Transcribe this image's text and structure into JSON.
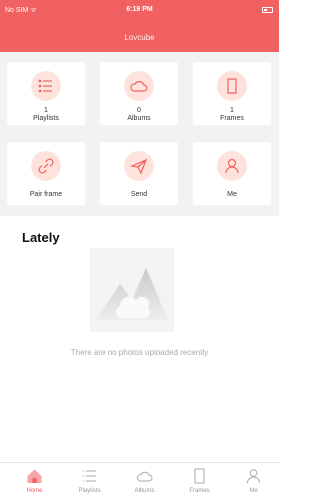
{
  "status": {
    "carrier": "No SIM ᯤ",
    "time": "6:19 PM"
  },
  "header": {
    "title": "Lovcube"
  },
  "cards": [
    {
      "count": "1",
      "label": "Playlists",
      "icon": "list-icon"
    },
    {
      "count": "0",
      "label": "Albums",
      "icon": "cloud-icon"
    },
    {
      "count": "1",
      "label": "Frames",
      "icon": "frame-icon"
    },
    {
      "label": "Pair frame",
      "icon": "link-icon"
    },
    {
      "label": "Send",
      "icon": "send-icon"
    },
    {
      "label": "Me",
      "icon": "person-icon"
    }
  ],
  "lately": {
    "title": "Lately",
    "empty_text": "There are no photos uploaded recently"
  },
  "tabs": [
    {
      "label": "Home",
      "active": true
    },
    {
      "label": "Playlists"
    },
    {
      "label": "Albums"
    },
    {
      "label": "Frames"
    },
    {
      "label": "Me"
    }
  ],
  "colors": {
    "accent": "#f26161",
    "icon_bg": "#fde3dc"
  }
}
